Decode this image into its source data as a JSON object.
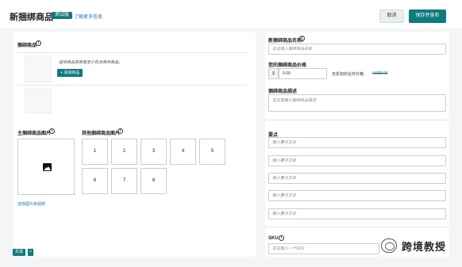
{
  "header": {
    "title": "新捆绑商品",
    "badge": "测试版",
    "learn_more": "了解更多信息",
    "cancel_label": "取消",
    "save_label": "保存并发布"
  },
  "bundle_items": {
    "label": "捆绑商品",
    "hint": "提供商品名称或至少包含两件商品。",
    "add_button": "+ 添加商品"
  },
  "images": {
    "main_label": "主捆绑商品图片",
    "other_label": "其他捆绑商品图片",
    "select_link": "选择图片和视频",
    "slots": [
      "1",
      "2",
      "3",
      "4",
      "5",
      "6",
      "7",
      "8"
    ]
  },
  "form": {
    "name_label": "新捆绑商品名称:",
    "name_placeholder": "在这输入捆绑商品名称",
    "price_label": "您的捆绑商品价格",
    "currency": "$",
    "price_value": "0.00",
    "recommend_label": "无折扣的合并价格:",
    "recommend_value": "US$0.00",
    "desc_label": "捆绑商品描述",
    "desc_placeholder": "在这里输入捆绑商品描述",
    "points_label": "要点",
    "bullet_placeholder": "输入要点文本",
    "sku_label": "SKU",
    "sku_placeholder": "在这输入一个SKU"
  },
  "footer": {
    "tag_label": "反馈",
    "tag_close": "×",
    "watermark": "跨境教授"
  },
  "colors": {
    "accent": "#0f7a80",
    "link": "#1a7fb5",
    "background": "#f3f5f6"
  }
}
